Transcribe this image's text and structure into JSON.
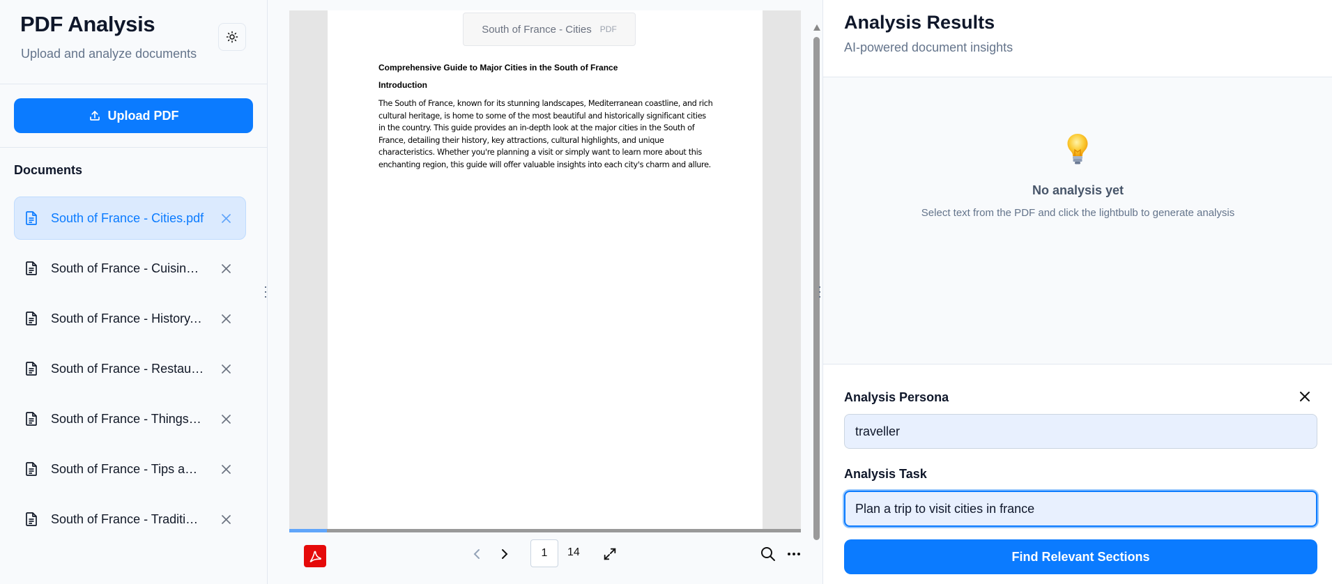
{
  "sidebar": {
    "title": "PDF Analysis",
    "subtitle": "Upload and analyze documents",
    "upload_label": "Upload PDF",
    "documents_title": "Documents",
    "documents": [
      {
        "label": "South of France - Cities.pdf",
        "active": true
      },
      {
        "label": "South of France - Cuisine.pdf",
        "active": false
      },
      {
        "label": "South of France - History.pdf",
        "active": false
      },
      {
        "label": "South of France - Restaurants and Hotels.pdf",
        "active": false
      },
      {
        "label": "South of France - Things to Do.pdf",
        "active": false
      },
      {
        "label": "South of France - Tips and Tricks.pdf",
        "active": false
      },
      {
        "label": "South of France - Traditions and Culture.pdf",
        "active": false
      }
    ]
  },
  "viewer": {
    "file_name": "South of France - Cities",
    "file_type": "PDF",
    "heading": "Comprehensive Guide to Major Cities in the South of France",
    "section": "Introduction",
    "body": "The South of France, known for its stunning landscapes, Mediterranean coastline, and rich cultural heritage, is home to some of the most beautiful and historically significant cities in the country. This guide provides an in-depth look at the major cities in the South of France, detailing their history, key attractions, cultural highlights, and unique characteristics. Whether you're planning a visit or simply want to learn more about this enchanting region, this guide will offer valuable insights into each city's charm and allure.",
    "current_page": "1",
    "total_pages": "14"
  },
  "results": {
    "title": "Analysis Results",
    "subtitle": "AI-powered document insights",
    "empty_title": "No analysis yet",
    "empty_desc": "Select text from the PDF and click the lightbulb to generate analysis"
  },
  "form": {
    "persona_label": "Analysis Persona",
    "persona_value": "traveller",
    "task_label": "Analysis Task",
    "task_value": "Plan a trip to visit cities in france",
    "submit_label": "Find Relevant Sections"
  },
  "colors": {
    "accent": "#0b7bff",
    "active_bg": "#dbeafe",
    "pdf_red": "#e50a0a"
  }
}
